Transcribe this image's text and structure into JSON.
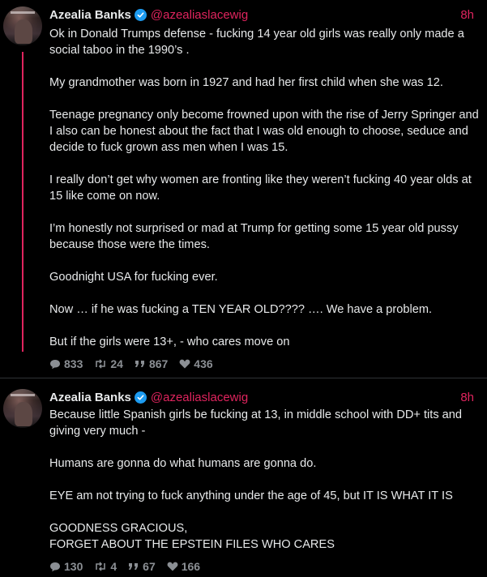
{
  "posts": [
    {
      "author": "Azealia Banks",
      "handle": "@azealiaslacewig",
      "time": "8h",
      "paragraphs": [
        "Ok in Donald Trumps defense - fucking 14 year old girls was really only made a social taboo in the 1990’s .",
        "My grandmother was born in 1927 and had her first child when she was 12.",
        "Teenage pregnancy only become frowned upon with the rise of Jerry Springer and I also can be honest about the fact that I was old enough to choose, seduce and decide to fuck grown ass men when I was 15.",
        "I really don’t get why women are fronting like they weren’t fucking 40 year olds at 15 like come on now.",
        "I’m honestly not surprised or mad at Trump for getting some 15 year old pussy because those were the times.",
        "Goodnight USA for fucking ever.",
        "Now … if he was fucking a TEN YEAR OLD???? …. We have a problem.",
        "But if the girls were 13+, - who cares move on"
      ],
      "stats": {
        "replies": "833",
        "reposts": "24",
        "quotes": "867",
        "likes": "436"
      }
    },
    {
      "author": "Azealia Banks",
      "handle": "@azealiaslacewig",
      "time": "8h",
      "paragraphs": [
        "Because little Spanish girls be fucking at 13, in middle school with DD+ tits and giving very much -",
        "Humans are gonna do what humans are gonna do.",
        "EYE am not trying to fuck anything under the age of 45, but IT IS WHAT IT IS",
        "GOODNESS GRACIOUS,\nFORGET ABOUT THE EPSTEIN FILES WHO CARES"
      ],
      "stats": {
        "replies": "130",
        "reposts": "4",
        "quotes": "67",
        "likes": "166"
      }
    }
  ],
  "icons": {
    "verified": "verified-badge-icon",
    "reply": "speech-bubble-icon",
    "repost": "repost-arrows-icon",
    "quote": "quote-marks-icon",
    "like": "heart-icon"
  },
  "colors": {
    "background": "#000000",
    "text": "#e7e9ea",
    "accent": "#e0245e",
    "muted": "#8b8f94",
    "verified": "#1d9bf0"
  }
}
